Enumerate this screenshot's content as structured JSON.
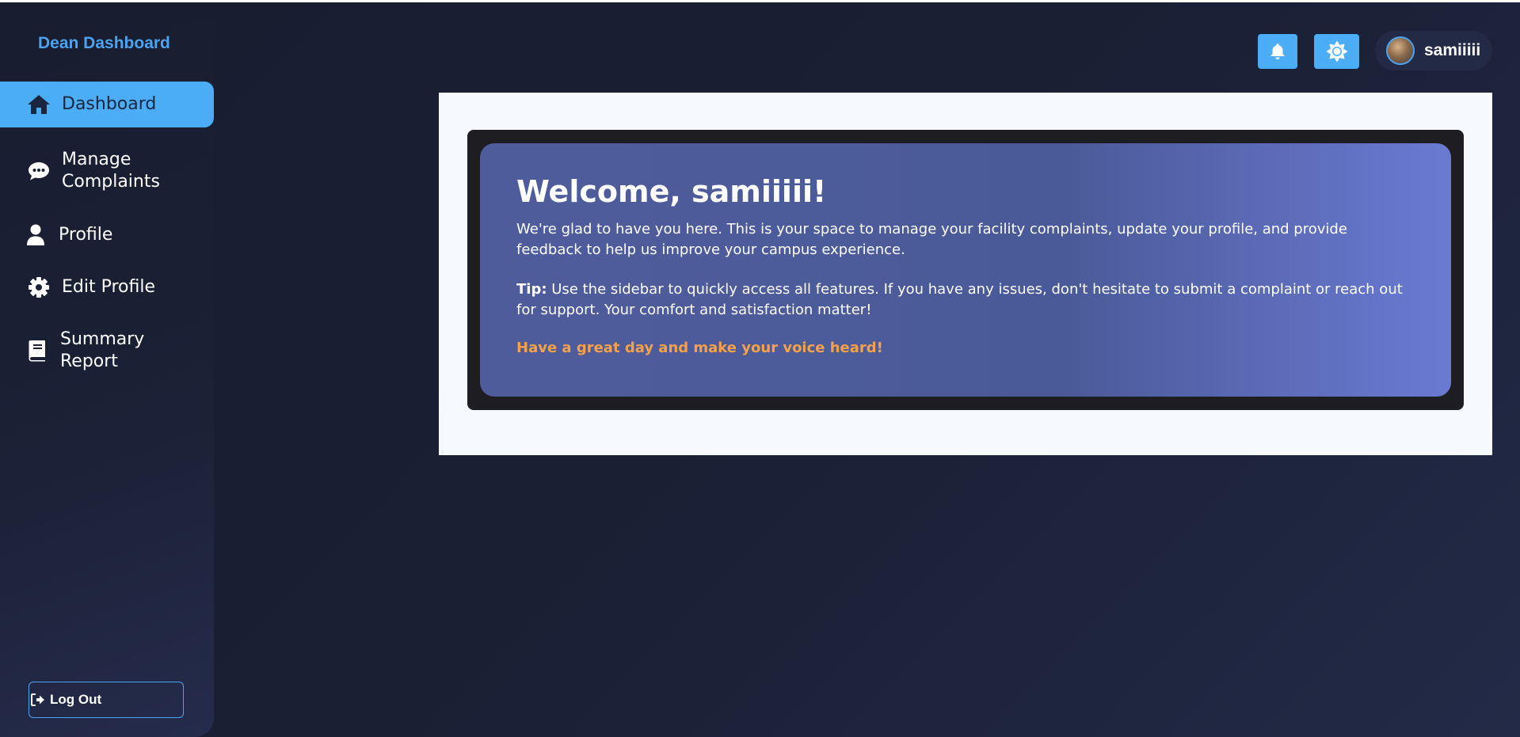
{
  "sidebar": {
    "brand": "Dean Dashboard",
    "items": [
      {
        "label": "Dashboard",
        "icon": "home-icon",
        "active": true
      },
      {
        "label": "Manage Complaints",
        "icon": "comment-icon"
      },
      {
        "label": "Profile",
        "icon": "user-icon"
      },
      {
        "label": "Edit Profile",
        "icon": "gear-icon"
      },
      {
        "label": "Summary Report",
        "icon": "book-icon"
      }
    ],
    "logout_label": "Log Out"
  },
  "header": {
    "username": "samiiiii"
  },
  "welcome": {
    "title": "Welcome, samiiiii!",
    "intro": "We're glad to have you here. This is your space to manage your facility complaints, update your profile, and provide feedback to help us improve your campus experience.",
    "tip_label": "Tip:",
    "tip_text": " Use the sidebar to quickly access all features. If you have any issues, don't hesitate to submit a complaint or reach out for support. Your comfort and satisfaction matter!",
    "closing": "Have a great day and make your voice heard!"
  },
  "colors": {
    "accent": "#4badf6",
    "background": "#1a2035",
    "card_gradient_start": "#4f5c9c",
    "card_gradient_end": "#6a7ad2",
    "highlight_text": "#f5a04a"
  }
}
